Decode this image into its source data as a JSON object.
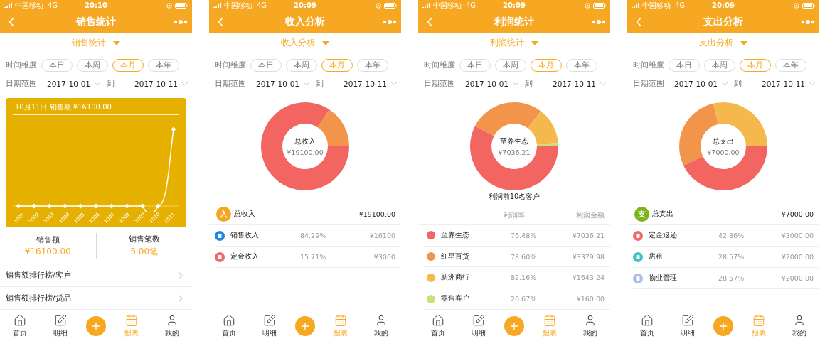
{
  "phones": [
    {
      "status_bar": {
        "carrier": "中国移动",
        "network": "4G",
        "time": "20:10"
      },
      "title": "销售统计",
      "dropdown": "销售统计",
      "time_filter": {
        "label": "时间维度",
        "options": [
          {
            "label": "本日",
            "selected": false
          },
          {
            "label": "本周",
            "selected": false
          },
          {
            "label": "本月",
            "selected": true
          },
          {
            "label": "本年",
            "selected": false
          }
        ]
      },
      "date_range": {
        "label": "日期范围",
        "start": "2017-10-01",
        "separator": "到",
        "end": "2017-10-11"
      },
      "content": {
        "kind": "sales",
        "chart_card": {
          "tooltip": "10月11日 销售额 ¥16100.00",
          "x_labels": [
            "1001",
            "1002",
            "1003",
            "1004",
            "1005",
            "1006",
            "1007",
            "1008",
            "1009",
            "1010",
            "1011"
          ]
        },
        "stats": [
          {
            "label": "销售额",
            "value": "¥16100.00"
          },
          {
            "label": "销售笔数",
            "value": "5.00笔"
          }
        ],
        "links": [
          "销售额排行榜/客户",
          "销售额排行榜/货品"
        ]
      },
      "tab_bar": [
        {
          "kind": "home",
          "label": "首页",
          "selected": false
        },
        {
          "kind": "detail",
          "label": "明细",
          "selected": false
        },
        {
          "kind": "add",
          "selected": false
        },
        {
          "kind": "report",
          "label": "报表",
          "selected": true
        },
        {
          "kind": "me",
          "label": "我的",
          "selected": false
        }
      ]
    },
    {
      "status_bar": {
        "carrier": "中国移动",
        "network": "4G",
        "time": "20:09"
      },
      "title": "收入分析",
      "dropdown": "收入分析",
      "time_filter": {
        "label": "时间维度",
        "options": [
          {
            "label": "本日",
            "selected": false
          },
          {
            "label": "本周",
            "selected": false
          },
          {
            "label": "本月",
            "selected": true
          },
          {
            "label": "本年",
            "selected": false
          }
        ]
      },
      "date_range": {
        "label": "日期范围",
        "start": "2017-10-01",
        "separator": "到",
        "end": "2017-10-11"
      },
      "content": {
        "kind": "breakdown",
        "donut": {
          "center_label": "总收入",
          "center_value": "¥19100.00",
          "chart_data": {
            "type": "donut",
            "values": [
              84.29,
              15.71
            ],
            "colors": [
              "#f26560",
              "#f2954a"
            ]
          }
        },
        "summary": {
          "badge": "入",
          "color": "#f6a623",
          "label": "总收入",
          "amount": "¥19100.00"
        },
        "rows": [
          {
            "name": "销售收入",
            "percent": "84.29%",
            "amount": "¥16100",
            "color": "#1e88e5"
          },
          {
            "name": "定金收入",
            "percent": "15.71%",
            "amount": "¥3000",
            "color": "#ef6b6b"
          }
        ]
      },
      "tab_bar": [
        {
          "kind": "home",
          "label": "首页",
          "selected": false
        },
        {
          "kind": "detail",
          "label": "明细",
          "selected": false
        },
        {
          "kind": "add",
          "selected": false
        },
        {
          "kind": "report",
          "label": "报表",
          "selected": true
        },
        {
          "kind": "me",
          "label": "我的",
          "selected": false
        }
      ]
    },
    {
      "status_bar": {
        "carrier": "中国移动",
        "network": "4G",
        "time": "20:09"
      },
      "title": "利润统计",
      "dropdown": "利润统计",
      "time_filter": {
        "label": "时间维度",
        "options": [
          {
            "label": "本日",
            "selected": false
          },
          {
            "label": "本周",
            "selected": false
          },
          {
            "label": "本月",
            "selected": true
          },
          {
            "label": "本年",
            "selected": false
          }
        ]
      },
      "date_range": {
        "label": "日期范围",
        "start": "2017-10-01",
        "separator": "到",
        "end": "2017-10-11"
      },
      "content": {
        "kind": "ranking",
        "donut": {
          "center_label": "至养生态",
          "center_value": "¥7036.21",
          "chart_data": {
            "type": "donut",
            "values": [
              57.58,
              27.66,
              13.45,
              1.31
            ],
            "colors": [
              "#f26560",
              "#f2954a",
              "#f5b84c",
              "#c6e27c"
            ]
          }
        },
        "caption": "利润前10名客户",
        "columns": [
          "利润率",
          "利润金额"
        ],
        "rows": [
          {
            "name": "至养生态",
            "rate": "76.48%",
            "amount": "¥7036.21",
            "color": "#f26560"
          },
          {
            "name": "红星百货",
            "rate": "78.60%",
            "amount": "¥3379.98",
            "color": "#f2954a"
          },
          {
            "name": "新洲商行",
            "rate": "82.16%",
            "amount": "¥1643.24",
            "color": "#f5b84c"
          },
          {
            "name": "零售客户",
            "rate": "26.67%",
            "amount": "¥160.00",
            "color": "#c6e27c"
          }
        ]
      },
      "tab_bar": [
        {
          "kind": "home",
          "label": "首页",
          "selected": false
        },
        {
          "kind": "detail",
          "label": "明细",
          "selected": false
        },
        {
          "kind": "add",
          "selected": false
        },
        {
          "kind": "report",
          "label": "报表",
          "selected": true
        },
        {
          "kind": "me",
          "label": "我的",
          "selected": false
        }
      ]
    },
    {
      "status_bar": {
        "carrier": "中国移动",
        "network": "4G",
        "time": "20:09"
      },
      "title": "支出分析",
      "dropdown": "支出分析",
      "time_filter": {
        "label": "时间维度",
        "options": [
          {
            "label": "本日",
            "selected": false
          },
          {
            "label": "本周",
            "selected": false
          },
          {
            "label": "本月",
            "selected": true
          },
          {
            "label": "本年",
            "selected": false
          }
        ]
      },
      "date_range": {
        "label": "日期范围",
        "start": "2017-10-01",
        "separator": "到",
        "end": "2017-10-11"
      },
      "content": {
        "kind": "breakdown",
        "donut": {
          "center_label": "总支出",
          "center_value": "¥7000.00",
          "chart_data": {
            "type": "donut",
            "values": [
              42.86,
              28.57,
              28.57
            ],
            "colors": [
              "#f26560",
              "#f2954a",
              "#f5b84c"
            ]
          }
        },
        "summary": {
          "badge": "支",
          "color": "#7cb518",
          "label": "总支出",
          "amount": "¥7000.00"
        },
        "rows": [
          {
            "name": "定金退还",
            "percent": "42.86%",
            "amount": "¥3000.00",
            "color": "#ef6b6b"
          },
          {
            "name": "房租",
            "percent": "28.57%",
            "amount": "¥2000.00",
            "color": "#3cc4c8"
          },
          {
            "name": "物业管理",
            "percent": "28.57%",
            "amount": "¥2000.00",
            "color": "#a9bfe4"
          }
        ]
      },
      "tab_bar": [
        {
          "kind": "home",
          "label": "首页",
          "selected": false
        },
        {
          "kind": "detail",
          "label": "明细",
          "selected": false
        },
        {
          "kind": "add",
          "selected": false
        },
        {
          "kind": "report",
          "label": "报表",
          "selected": true
        },
        {
          "kind": "me",
          "label": "我的",
          "selected": false
        }
      ]
    }
  ]
}
